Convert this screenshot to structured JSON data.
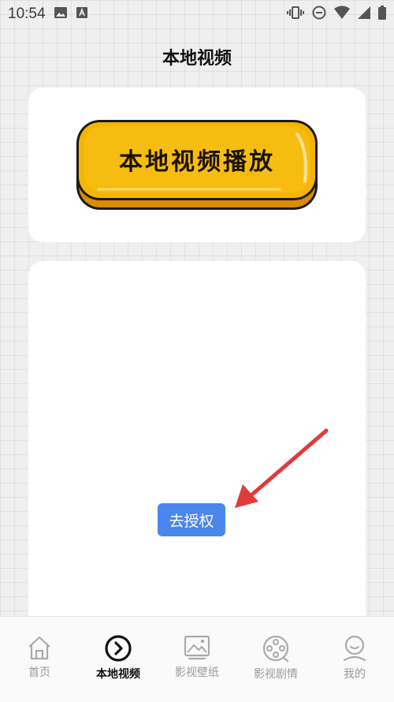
{
  "status_bar": {
    "time": "10:54",
    "left_icons": [
      "image-icon",
      "a-text-icon"
    ],
    "right_icons": [
      "vibrate-icon",
      "do-not-disturb-icon",
      "wifi-icon",
      "signal-icon",
      "battery-icon"
    ]
  },
  "header": {
    "title": "本地视频"
  },
  "play_button": {
    "label": "本地视频播放"
  },
  "auth_button": {
    "label": "去授权"
  },
  "tabs": [
    {
      "label": "首页",
      "icon": "home-icon",
      "active": false
    },
    {
      "label": "本地视频",
      "icon": "play-circle-icon",
      "active": true
    },
    {
      "label": "影视壁纸",
      "icon": "picture-icon",
      "active": false
    },
    {
      "label": "影视剧情",
      "icon": "film-reel-icon",
      "active": false
    },
    {
      "label": "我的",
      "icon": "user-icon",
      "active": false
    }
  ],
  "colors": {
    "accent_yellow": "#f4b400",
    "button_blue": "#4a86ec",
    "arrow_red": "#e03a3a"
  }
}
